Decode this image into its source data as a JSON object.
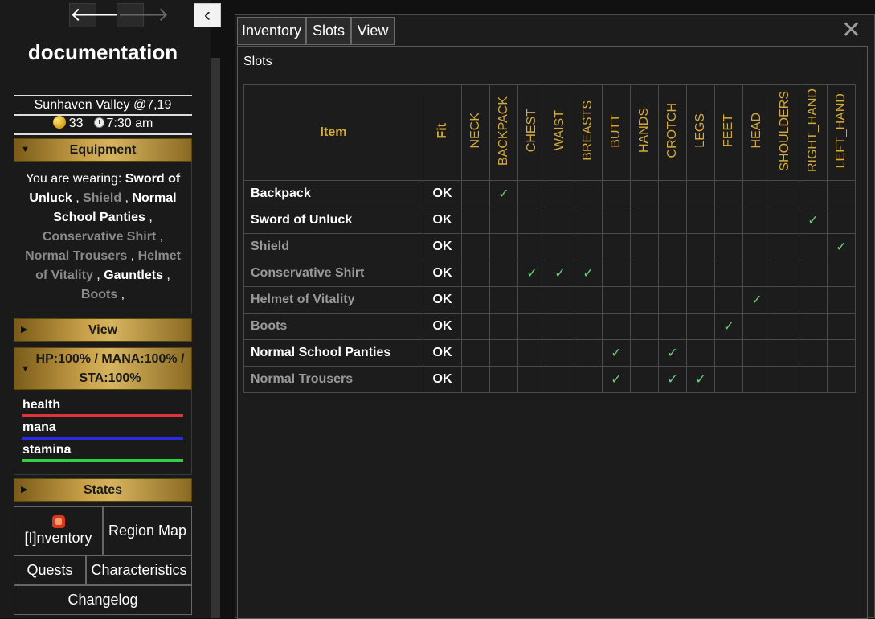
{
  "sidebar": {
    "title": "documentation",
    "location": "Sunhaven Valley @7,19",
    "gold": "33",
    "time": "7:30 am",
    "equipment": {
      "header": "Equipment",
      "intro": "You are wearing: ",
      "items": [
        {
          "name": "Sword of Unluck",
          "style": "bold"
        },
        {
          "name": "Shield",
          "style": "grey"
        },
        {
          "name": "Normal School Panties",
          "style": "bold"
        },
        {
          "name": "Conservative Shirt",
          "style": "grey"
        },
        {
          "name": "Normal Trousers",
          "style": "grey"
        },
        {
          "name": "Helmet of Vitality",
          "style": "grey"
        },
        {
          "name": "Gauntlets",
          "style": "bold"
        },
        {
          "name": "Boots",
          "style": "grey"
        }
      ]
    },
    "view_header": "View",
    "stats_header": "HP:100% / MANA:100% / STA:100%",
    "bars": [
      {
        "label": "health",
        "color": "#e0323a",
        "percent": 100
      },
      {
        "label": "mana",
        "color": "#2a2ae0",
        "percent": 100
      },
      {
        "label": "stamina",
        "color": "#30d040",
        "percent": 100
      }
    ],
    "states_header": "States",
    "buttons": {
      "inventory": "[I]nventory",
      "region_map": "Region Map",
      "quests": "Quests",
      "characteristics": "Characteristics",
      "changelog": "Changelog"
    }
  },
  "dialog": {
    "tabs": [
      "Inventory",
      "Slots",
      "View"
    ],
    "section_title": "Slots",
    "table": {
      "item_header": "Item",
      "fit_header": "Fit",
      "slots": [
        "NECK",
        "BACKPACK",
        "CHEST",
        "WAIST",
        "BREASTS",
        "BUTT",
        "HANDS",
        "CROTCH",
        "LEGS",
        "FEET",
        "HEAD",
        "SHOULDERS",
        "RIGHT_HAND",
        "LEFT_HAND"
      ],
      "rows": [
        {
          "item": "Backpack",
          "style": "bold",
          "fit": "OK",
          "checked": [
            "BACKPACK"
          ]
        },
        {
          "item": "Sword of Unluck",
          "style": "bold",
          "fit": "OK",
          "checked": [
            "RIGHT_HAND"
          ]
        },
        {
          "item": "Shield",
          "style": "grey",
          "fit": "OK",
          "checked": [
            "LEFT_HAND"
          ]
        },
        {
          "item": "Conservative Shirt",
          "style": "grey",
          "fit": "OK",
          "checked": [
            "CHEST",
            "WAIST",
            "BREASTS"
          ]
        },
        {
          "item": "Helmet of Vitality",
          "style": "grey",
          "fit": "OK",
          "checked": [
            "HEAD"
          ]
        },
        {
          "item": "Boots",
          "style": "grey",
          "fit": "OK",
          "checked": [
            "FEET"
          ]
        },
        {
          "item": "Normal School Panties",
          "style": "bold",
          "fit": "OK",
          "checked": [
            "BUTT",
            "CROTCH"
          ]
        },
        {
          "item": "Normal Trousers",
          "style": "grey",
          "fit": "OK",
          "checked": [
            "BUTT",
            "CROTCH",
            "LEGS"
          ]
        }
      ],
      "check_glyph": "✓"
    }
  },
  "colors": {
    "gold_header": "#d4aa3c",
    "check": "#6fd17a"
  }
}
